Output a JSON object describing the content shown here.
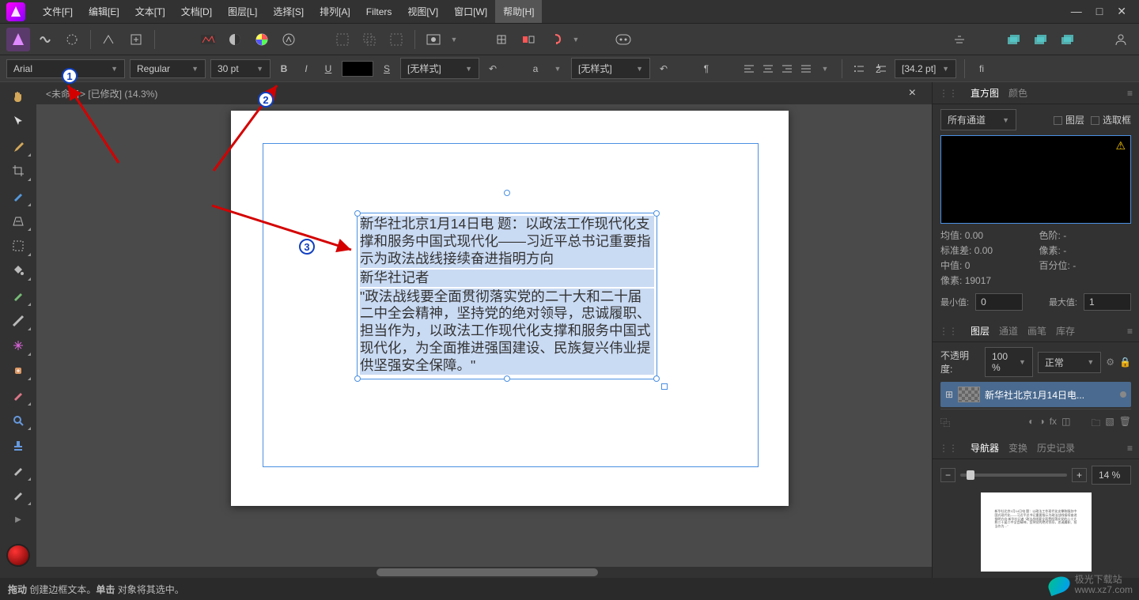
{
  "menu": {
    "items": [
      "文件[F]",
      "编辑[E]",
      "文本[T]",
      "文档[D]",
      "图层[L]",
      "选择[S]",
      "排列[A]",
      "Filters",
      "视图[V]",
      "窗口[W]",
      "帮助[H]"
    ],
    "active_index": 10
  },
  "window_controls": {
    "min": "—",
    "max": "□",
    "close": "✕"
  },
  "context_toolbar": {
    "font_family": "Arial",
    "font_style": "Regular",
    "font_size": "30 pt",
    "char_style": "[无样式]",
    "para_style": "[无样式]",
    "leading": "[34.2 pt]"
  },
  "document_tab": {
    "title": "<未命名> [已修改] (14.3%)"
  },
  "tools": {
    "items": [
      "hand",
      "move",
      "brush",
      "crop",
      "paint",
      "grid",
      "marquee",
      "pen",
      "smudge",
      "gradient",
      "sparkle",
      "heal",
      "clone",
      "magnify",
      "stamp",
      "mask",
      "eraser",
      "more"
    ]
  },
  "text_content": {
    "p1": "新华社北京1月14日电 题：以政法工作现代化支撑和服务中国式现代化——习近平总书记重要指示为政法战线接续奋进指明方向",
    "p2": "新华社记者",
    "p3": "\"政法战线要全面贯彻落实党的二十大和二十届二中全会精神，坚持党的绝对领导，忠诚履职、担当作为，以政法工作现代化支撑和服务中国式现代化，为全面推进强国建设、民族复兴伟业提供坚强安全保障。\""
  },
  "histogram": {
    "tabs": [
      "直方图",
      "颜色"
    ],
    "channel": "所有通道",
    "layer_chk": "图层",
    "selection_chk": "选取框",
    "stats": {
      "mean_label": "均值:",
      "mean": "0.00",
      "stddev_label": "标准差:",
      "stddev": "0.00",
      "median_label": "中值:",
      "median": "0",
      "pixels_label": "像素:",
      "pixels": "19017",
      "levels_label": "色阶:",
      "levels": "-",
      "image_label": "像素:",
      "image_val": "-",
      "percent_label": "百分位:",
      "percent": "-"
    },
    "min_label": "最小值:",
    "min": "0",
    "max_label": "最大值:",
    "max": "1"
  },
  "layers": {
    "tabs": [
      "图层",
      "通道",
      "画笔",
      "库存"
    ],
    "opacity_label": "不透明度:",
    "opacity": "100 %",
    "blend_mode": "正常",
    "layer_name": "新华社北京1月14日电..."
  },
  "navigator": {
    "tabs": [
      "导航器",
      "变换",
      "历史记录"
    ],
    "zoom": "14 %"
  },
  "statusbar": {
    "drag_label": "拖动",
    "drag_text": "创建边框文本。",
    "click_label": "单击",
    "click_text": "对象将其选中。"
  },
  "watermark": {
    "line1": "极光下载站",
    "line2": "www.xz7.com"
  },
  "callouts": {
    "c1": "1",
    "c2": "2",
    "c3": "3"
  }
}
